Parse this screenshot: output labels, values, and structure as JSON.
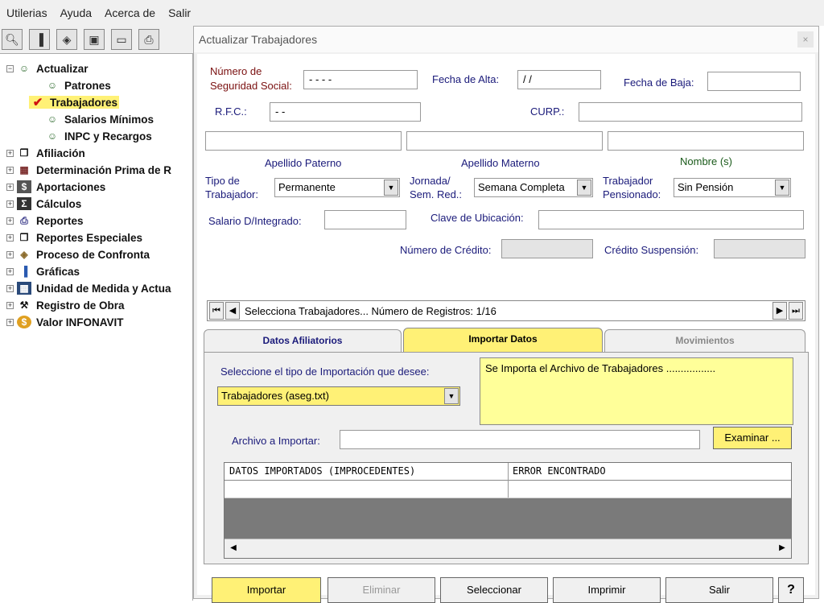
{
  "menu": [
    "Utilerias",
    "Ayuda",
    "Acerca de",
    "Salir"
  ],
  "toolbar_icons": [
    "magnifier-icon",
    "bar-chart-icon",
    "box-icon",
    "floppy-disk-icon",
    "eraser-icon",
    "printer-icon"
  ],
  "tree": {
    "items": [
      {
        "label": "Actualizar",
        "expanded": true
      },
      {
        "label": "Patrones"
      },
      {
        "label": "Trabajadores",
        "selected": true
      },
      {
        "label": "Salarios Mínimos"
      },
      {
        "label": "INPC y Recargos"
      },
      {
        "label": "Afiliación"
      },
      {
        "label": "Determinación Prima de R"
      },
      {
        "label": "Aportaciones"
      },
      {
        "label": "Cálculos"
      },
      {
        "label": "Reportes"
      },
      {
        "label": "Reportes Especiales"
      },
      {
        "label": "Proceso de Confronta"
      },
      {
        "label": "Gráficas"
      },
      {
        "label": "Unidad de Medida y Actua"
      },
      {
        "label": "Registro de Obra"
      },
      {
        "label": "Valor INFONAVIT"
      }
    ]
  },
  "dialog": {
    "title": "Actualizar Trabajadores",
    "close": "×",
    "form": {
      "nss_label_1": "Número de",
      "nss_label_2": "Seguridad Social:",
      "nss_value": "-  -  -  -",
      "fecha_alta_label": "Fecha de Alta:",
      "fecha_alta_value": "/ /",
      "fecha_baja_label": "Fecha de Baja:",
      "rfc_label": "R.F.C.:",
      "rfc_value": "-     -",
      "curp_label": "CURP.:",
      "apellido_paterno": "Apellido Paterno",
      "apellido_materno": "Apellido Materno",
      "nombre": "Nombre (s)",
      "tipo_label_1": "Tipo de",
      "tipo_label_2": "Trabajador:",
      "tipo_value": "Permanente",
      "jornada_label_1": "Jornada/",
      "jornada_label_2": "Sem. Red.:",
      "jornada_value": "Semana Completa",
      "pensionado_label_1": "Trabajador",
      "pensionado_label_2": "Pensionado:",
      "pensionado_value": "Sin Pensión",
      "salario_label": "Salario D/Integrado:",
      "clave_label": "Clave de Ubicación:",
      "credito_label": "Número de Crédito:",
      "suspension_label": "Crédito Suspensión:"
    },
    "nav": {
      "text": "Selecciona Trabajadores...  Número de Registros:  1/16"
    },
    "tabs": [
      {
        "label": "Datos Afiliatorios"
      },
      {
        "label": "Importar Datos",
        "active": true
      },
      {
        "label": "Movimientos"
      }
    ],
    "import": {
      "prompt": "Seleccione el tipo de Importación que desee:",
      "type_value": "Trabajadores (aseg.txt)",
      "info": "Se Importa el Archivo de Trabajadores .................",
      "file_label": "Archivo a Importar:",
      "browse": "Examinar ...",
      "grid_headers": [
        "DATOS IMPORTADOS (IMPROCEDENTES)",
        "ERROR ENCONTRADO"
      ]
    },
    "buttons": {
      "importar": "Importar",
      "eliminar": "Eliminar",
      "seleccionar": "Seleccionar",
      "imprimir": "Imprimir",
      "salir": "Salir",
      "help": "?"
    }
  }
}
